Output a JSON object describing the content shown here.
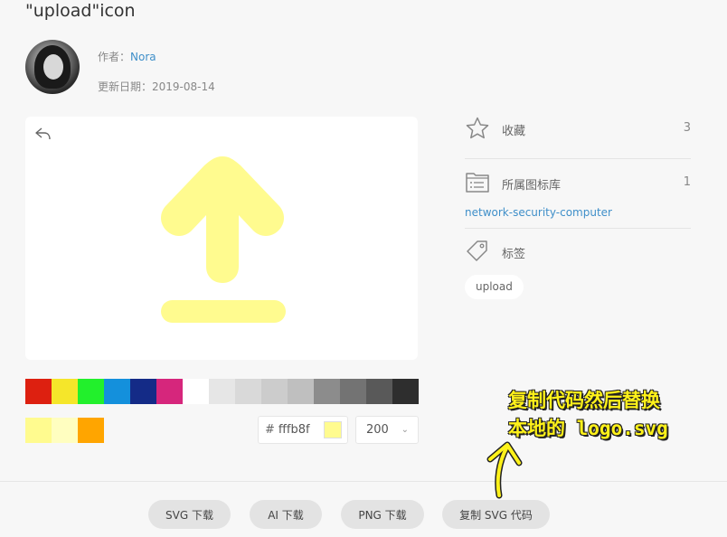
{
  "page": {
    "title": "\"upload\"icon"
  },
  "author": {
    "label": "作者：",
    "name": "Nora"
  },
  "updated": {
    "label": "更新日期：",
    "date": "2019-08-14"
  },
  "preview": {
    "icon_color": "#fffb8f",
    "back_icon": "undo-icon"
  },
  "palette": {
    "colors": [
      "#dd2010",
      "#f5e62a",
      "#22f02c",
      "#1490dc",
      "#142b87",
      "#d6267c",
      "#ffffff",
      "#e6e6e6",
      "#d9d9d9",
      "#cccccc",
      "#bfbfbf",
      "#8c8c8c",
      "#737373",
      "#595959",
      "#2e2e2e"
    ],
    "recent": [
      "#fffb8f",
      "#fffec0",
      "#ffa500"
    ]
  },
  "color_input": {
    "hash": "#",
    "value": "fffb8f",
    "chip_color": "#fffb8f"
  },
  "size_select": {
    "value": "200"
  },
  "sidebar": {
    "collect": {
      "icon": "star-icon",
      "label": "收藏",
      "count": "3"
    },
    "library": {
      "icon": "list-folder-icon",
      "label": "所属图标库",
      "count": "1",
      "link": "network-security-computer"
    },
    "tags": {
      "icon": "tag-icon",
      "label": "标签",
      "items": [
        "upload"
      ]
    }
  },
  "buttons": {
    "svg_download": "SVG 下载",
    "ai_download": "AI 下载",
    "png_download": "PNG 下载",
    "copy_svg": "复制 SVG 代码"
  },
  "annotation": {
    "line1": "复制代码然后替换",
    "line2": "本地的 logo.svg",
    "color": "#fff21a"
  }
}
